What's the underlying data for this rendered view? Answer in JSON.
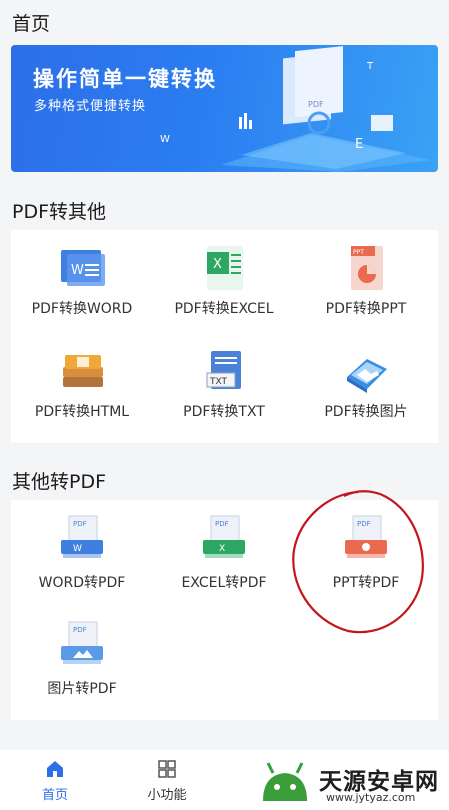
{
  "home": {
    "title": "首页"
  },
  "banner": {
    "headline": "操作简单一键转换",
    "subline": "多种格式便捷转换"
  },
  "pdf_to_other": {
    "title": "PDF转其他",
    "items": [
      {
        "label": "PDF转换WORD",
        "icon": "word-doc-icon"
      },
      {
        "label": "PDF转换EXCEL",
        "icon": "excel-doc-icon"
      },
      {
        "label": "PDF转换PPT",
        "icon": "ppt-doc-icon"
      },
      {
        "label": "PDF转换HTML",
        "icon": "html-book-icon"
      },
      {
        "label": "PDF转换TXT",
        "icon": "txt-doc-icon"
      },
      {
        "label": "PDF转换图片",
        "icon": "image-icon"
      }
    ]
  },
  "other_to_pdf": {
    "title": "其他转PDF",
    "items": [
      {
        "label": "WORD转PDF",
        "icon": "word-to-pdf-icon"
      },
      {
        "label": "EXCEL转PDF",
        "icon": "excel-to-pdf-icon"
      },
      {
        "label": "PPT转PDF",
        "icon": "ppt-to-pdf-icon"
      },
      {
        "label": "图片转PDF",
        "icon": "image-to-pdf-icon"
      }
    ]
  },
  "nav": {
    "home": {
      "label": "首页",
      "active": true
    },
    "tools": {
      "label": "小功能",
      "active": false
    }
  },
  "watermark": {
    "name": "天源安卓网",
    "url": "www.jytyaz.com"
  },
  "colors": {
    "accent": "#2d6fe8",
    "word": "#3f7fe0",
    "excel": "#2ea765",
    "ppt": "#e96a4f",
    "annotation": "#c4151c"
  }
}
